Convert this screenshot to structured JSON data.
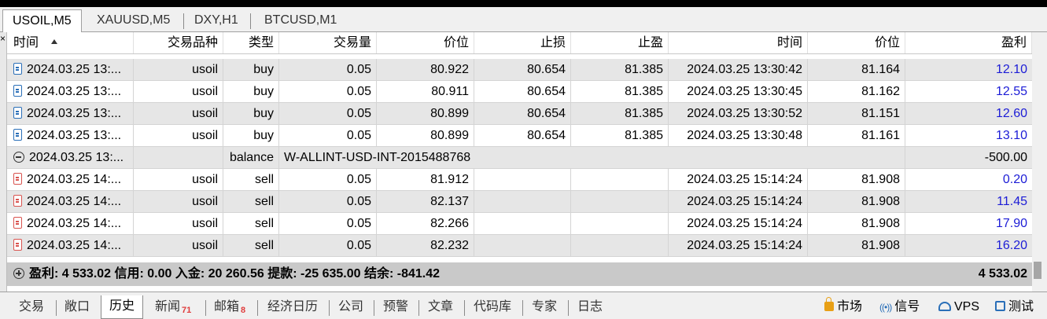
{
  "chart_tabs": [
    "USOIL,M5",
    "XAUUSD,M5",
    "DXY,H1",
    "BTCUSD,M1"
  ],
  "columns": [
    "时间",
    "交易品种",
    "类型",
    "交易量",
    "价位",
    "止损",
    "止盈",
    "时间",
    "价位",
    "盈利"
  ],
  "rows": [
    {
      "icon": "buy",
      "open_time": "2024.03.25 13:...",
      "symbol": "usoil",
      "type": "buy",
      "volume": "0.05",
      "price": "80.922",
      "sl": "80.654",
      "tp": "81.385",
      "close_time": "2024.03.25 13:30:42",
      "close_price": "81.164",
      "profit": "12.10"
    },
    {
      "icon": "buy",
      "open_time": "2024.03.25 13:...",
      "symbol": "usoil",
      "type": "buy",
      "volume": "0.05",
      "price": "80.911",
      "sl": "80.654",
      "tp": "81.385",
      "close_time": "2024.03.25 13:30:45",
      "close_price": "81.162",
      "profit": "12.55"
    },
    {
      "icon": "buy",
      "open_time": "2024.03.25 13:...",
      "symbol": "usoil",
      "type": "buy",
      "volume": "0.05",
      "price": "80.899",
      "sl": "80.654",
      "tp": "81.385",
      "close_time": "2024.03.25 13:30:52",
      "close_price": "81.151",
      "profit": "12.60"
    },
    {
      "icon": "buy",
      "open_time": "2024.03.25 13:...",
      "symbol": "usoil",
      "type": "buy",
      "volume": "0.05",
      "price": "80.899",
      "sl": "80.654",
      "tp": "81.385",
      "close_time": "2024.03.25 13:30:48",
      "close_price": "81.161",
      "profit": "13.10"
    }
  ],
  "balance_row": {
    "open_time": "2024.03.25 13:...",
    "type": "balance",
    "comment": "W-ALLINT-USD-INT-2015488768",
    "profit": "-500.00"
  },
  "sell_rows": [
    {
      "open_time": "2024.03.25 14:...",
      "symbol": "usoil",
      "type": "sell",
      "volume": "0.05",
      "price": "81.912",
      "close_time": "2024.03.25 15:14:24",
      "close_price": "81.908",
      "profit": "0.20"
    },
    {
      "open_time": "2024.03.25 14:...",
      "symbol": "usoil",
      "type": "sell",
      "volume": "0.05",
      "price": "82.137",
      "close_time": "2024.03.25 15:14:24",
      "close_price": "81.908",
      "profit": "11.45"
    },
    {
      "open_time": "2024.03.25 14:...",
      "symbol": "usoil",
      "type": "sell",
      "volume": "0.05",
      "price": "82.266",
      "close_time": "2024.03.25 15:14:24",
      "close_price": "81.908",
      "profit": "17.90"
    },
    {
      "open_time": "2024.03.25 14:...",
      "symbol": "usoil",
      "type": "sell",
      "volume": "0.05",
      "price": "82.232",
      "close_time": "2024.03.25 15:14:24",
      "close_price": "81.908",
      "profit": "16.20"
    }
  ],
  "summary": {
    "text": "盈利: 4 533.02  信用: 0.00  入金: 20 260.56  提款: -25 635.00  结余: -841.42",
    "total": "4 533.02"
  },
  "bottom_tabs": [
    {
      "label": "交易"
    },
    {
      "label": "敞口"
    },
    {
      "label": "历史"
    },
    {
      "label": "新闻",
      "badge": "71"
    },
    {
      "label": "邮箱",
      "badge": "8"
    },
    {
      "label": "经济日历"
    },
    {
      "label": "公司"
    },
    {
      "label": "预警"
    },
    {
      "label": "文章"
    },
    {
      "label": "代码库"
    },
    {
      "label": "专家"
    },
    {
      "label": "日志"
    }
  ],
  "status": {
    "market": "市场",
    "signals": "信号",
    "vps": "VPS",
    "tester": "测试"
  },
  "colors": {
    "profit": "#1c1cd6",
    "badge": "#e03c3c",
    "buy_icon": "#2a6fb8",
    "sell_icon": "#d9534f"
  }
}
